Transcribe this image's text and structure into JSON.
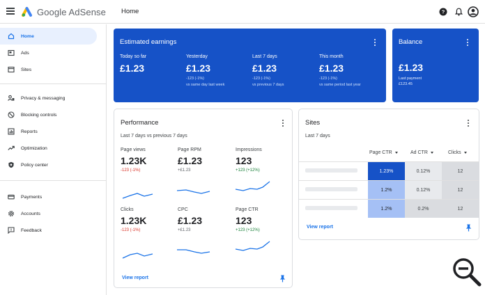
{
  "header": {
    "brand": "Google AdSense",
    "page_title": "Home"
  },
  "icons": {
    "menu": "menu-icon",
    "help": "help-icon",
    "notifications": "bell-icon",
    "account": "account-circle-icon",
    "zoom": "zoom-out-icon"
  },
  "colors": {
    "primary_blue": "#1652c7",
    "accent_blue": "#1a73e8",
    "negative": "#d93025",
    "positive": "#188038"
  },
  "sidebar": {
    "items": [
      {
        "label": "Home",
        "icon": "home-icon"
      },
      {
        "label": "Ads",
        "icon": "ads-icon"
      },
      {
        "label": "Sites",
        "icon": "sites-icon"
      },
      {
        "label": "Privacy & messaging",
        "icon": "privacy-icon"
      },
      {
        "label": "Blocking controls",
        "icon": "block-icon"
      },
      {
        "label": "Reports",
        "icon": "reports-icon"
      },
      {
        "label": "Optimization",
        "icon": "trending-icon"
      },
      {
        "label": "Policy center",
        "icon": "policy-icon"
      },
      {
        "label": "Payments",
        "icon": "payments-icon"
      },
      {
        "label": "Accounts",
        "icon": "settings-icon"
      },
      {
        "label": "Feedback",
        "icon": "feedback-icon"
      }
    ]
  },
  "earnings": {
    "title": "Estimated earnings",
    "columns": [
      {
        "label": "Today so far",
        "value": "£1.23",
        "delta": "",
        "compare": ""
      },
      {
        "label": "Yesterday",
        "value": "£1.23",
        "delta": "-123 (-1%)",
        "compare": "vs same day last week"
      },
      {
        "label": "Last 7 days",
        "value": "£1.23",
        "delta": "-123 (-1%)",
        "compare": "vs previous 7 days"
      },
      {
        "label": "This month",
        "value": "£1.23",
        "delta": "-123 (-1%)",
        "compare": "vs same period last year"
      }
    ]
  },
  "balance": {
    "title": "Balance",
    "value": "£1.23",
    "last_payment_label": "Last payment",
    "last_payment_value": "£123.45"
  },
  "performance": {
    "title": "Performance",
    "subtitle": "Last 7 days vs previous 7 days",
    "metrics": [
      {
        "label": "Page views",
        "value": "1.23K",
        "delta": "-123 (-1%)",
        "trend": "neg"
      },
      {
        "label": "Page RPM",
        "value": "£1.23",
        "delta": "+£1.23",
        "trend": "neu"
      },
      {
        "label": "Impressions",
        "value": "123",
        "delta": "+123 (+12%)",
        "trend": "pos"
      },
      {
        "label": "Clicks",
        "value": "1.23K",
        "delta": "-123 (-1%)",
        "trend": "neg"
      },
      {
        "label": "CPC",
        "value": "£1.23",
        "delta": "+£1.23",
        "trend": "neu"
      },
      {
        "label": "Page CTR",
        "value": "123",
        "delta": "+123 (+12%)",
        "trend": "pos"
      }
    ],
    "view_report": "View report"
  },
  "sites": {
    "title": "Sites",
    "subtitle": "Last 7 days",
    "columns": [
      "Page CTR",
      "Ad CTR",
      "Clicks"
    ],
    "rows": [
      [
        "1.23%",
        "0.12%",
        "12"
      ],
      [
        "1.2%",
        "0.12%",
        "12"
      ],
      [
        "1.2%",
        "0.2%",
        "12"
      ]
    ],
    "view_report": "View report"
  }
}
